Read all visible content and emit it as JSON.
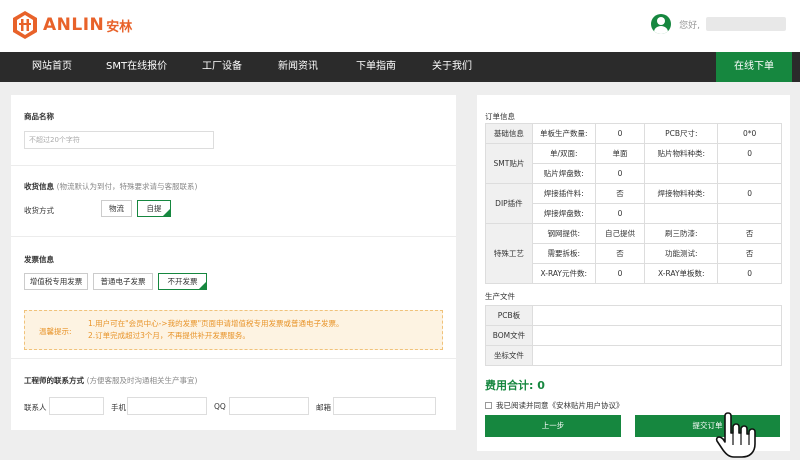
{
  "header": {
    "logo_text": "ANLIN",
    "logo_cn": "安林",
    "greeting": "您好,"
  },
  "nav": {
    "items": [
      "网站首页",
      "SMT在线报价",
      "工厂设备",
      "新闻资讯",
      "下单指南",
      "关于我们"
    ],
    "order_button": "在线下单"
  },
  "product": {
    "title": "商品名称",
    "placeholder": "不超过20个字符"
  },
  "shipping": {
    "title": "收货信息",
    "note": "(物流默认为到付，特殊要求请与客服联系)",
    "method_label": "收货方式",
    "options": [
      "物流",
      "自提"
    ],
    "selected": "自提"
  },
  "invoice": {
    "title": "发票信息",
    "options": [
      "增值税专用发票",
      "普通电子发票",
      "不开发票"
    ],
    "selected": "不开发票",
    "tip_label": "温馨提示:",
    "tip_lines": [
      "1.用户可在\"会员中心->我的发票\"页面申请增值税专用发票或普通电子发票。",
      "2.订单完成超过3个月，不再提供补开发票服务。"
    ]
  },
  "engineer": {
    "title": "工程师的联系方式",
    "note": "(方便客服及时沟通相关生产事宜)",
    "fields": [
      "联系人",
      "手机",
      "QQ",
      "邮箱"
    ]
  },
  "order_info": {
    "title": "订单信息",
    "rows": {
      "basic": {
        "group": "基础信息",
        "c1": "单板生产数量:",
        "v1": "0",
        "c2": "PCB尺寸:",
        "v2": "0*0"
      },
      "smt": {
        "group": "SMT贴片",
        "r1": {
          "c1": "单/双面:",
          "v1": "单面",
          "c2": "贴片物料种类:",
          "v2": "0"
        },
        "r2": {
          "c1": "贴片焊盘数:",
          "v1": "0"
        }
      },
      "dip": {
        "group": "DIP插件",
        "r1": {
          "c1": "焊接插件料:",
          "v1": "否",
          "c2": "焊接物料种类:",
          "v2": "0"
        },
        "r2": {
          "c1": "焊接焊盘数:",
          "v1": "0"
        }
      },
      "special": {
        "group": "特殊工艺",
        "r1": {
          "c1": "钢网提供:",
          "v1": "自己提供",
          "c2": "刷三防漆:",
          "v2": "否"
        },
        "r2": {
          "c1": "需要拆板:",
          "v1": "否",
          "c2": "功能测试:",
          "v2": "否"
        },
        "r3": {
          "c1": "X-RAY元件数:",
          "v1": "0",
          "c2": "X-RAY单板数:",
          "v2": "0"
        }
      }
    }
  },
  "production_files": {
    "title": "生产文件",
    "files": [
      "PCB板",
      "BOM文件",
      "坐标文件"
    ]
  },
  "total": {
    "label": "费用合计:",
    "value": "0"
  },
  "agreement": "我已阅读并同意《安林贴片用户协议》",
  "buttons": {
    "prev": "上一步",
    "submit": "提交订单"
  }
}
